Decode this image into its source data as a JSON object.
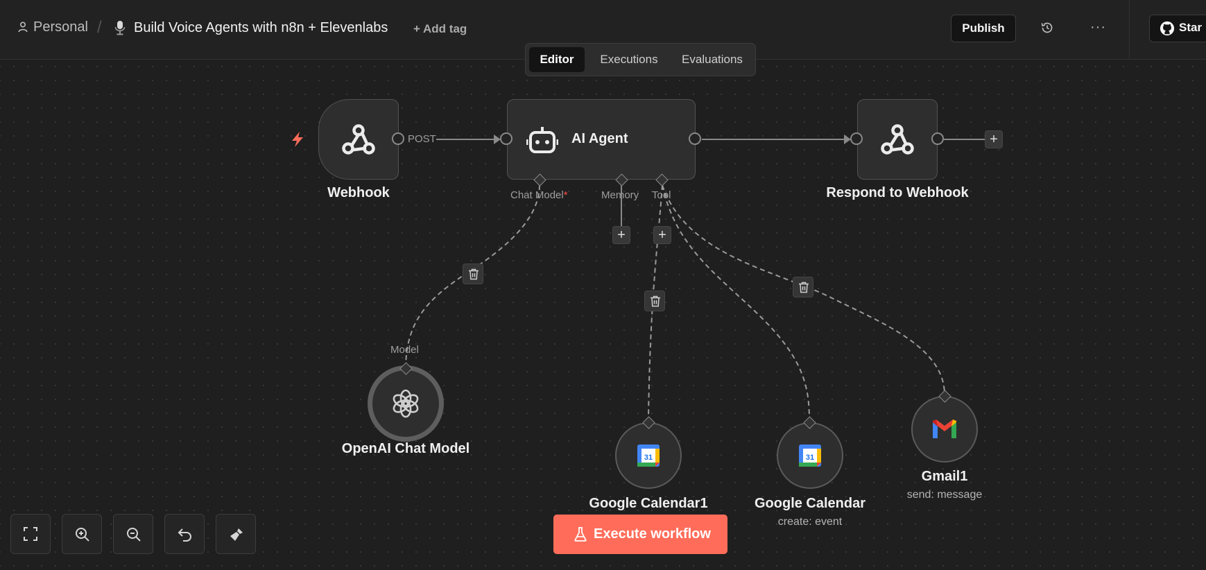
{
  "header": {
    "project": "Personal",
    "separator": "/",
    "workflow_title": "Build Voice Agents with n8n + Elevenlabs",
    "add_tag": "+ Add tag",
    "publish": "Publish",
    "more": "···",
    "github_star": "Star"
  },
  "tabs": [
    {
      "label": "Editor",
      "active": true
    },
    {
      "label": "Executions",
      "active": false
    },
    {
      "label": "Evaluations",
      "active": false
    }
  ],
  "nodes": {
    "webhook": {
      "label": "Webhook",
      "output_label": "POST",
      "icon": "webhook-icon",
      "trigger_icon": "lightning-bolt-icon"
    },
    "ai_agent": {
      "label": "AI Agent",
      "icon": "robot-icon",
      "ports": {
        "chat_model": "Chat Model",
        "chat_model_required": "*",
        "memory": "Memory",
        "tool": "Tool"
      }
    },
    "respond": {
      "label": "Respond to Webhook",
      "icon": "webhook-icon"
    },
    "openai": {
      "label": "OpenAI Chat Model",
      "port_label": "Model",
      "icon": "openai-icon"
    },
    "gcal1": {
      "label": "Google Calendar1",
      "icon": "google-calendar-icon",
      "icon_text": "31"
    },
    "gcal": {
      "label": "Google Calendar",
      "subtitle": "create: event",
      "icon": "google-calendar-icon",
      "icon_text": "31"
    },
    "gmail": {
      "label": "Gmail1",
      "subtitle": "send: message",
      "icon": "gmail-icon"
    }
  },
  "plus_symbol": "+",
  "controls": {
    "buttons": [
      "fit-view-icon",
      "zoom-in-icon",
      "zoom-out-icon",
      "undo-icon",
      "tidy-up-icon"
    ],
    "execute": "Execute workflow"
  },
  "colors": {
    "canvas_bg": "#1f1f1f",
    "execute_button": "#ff6d5a",
    "trigger_bolt": "#ff6d5a",
    "required_marker": "#ff4d4d"
  }
}
